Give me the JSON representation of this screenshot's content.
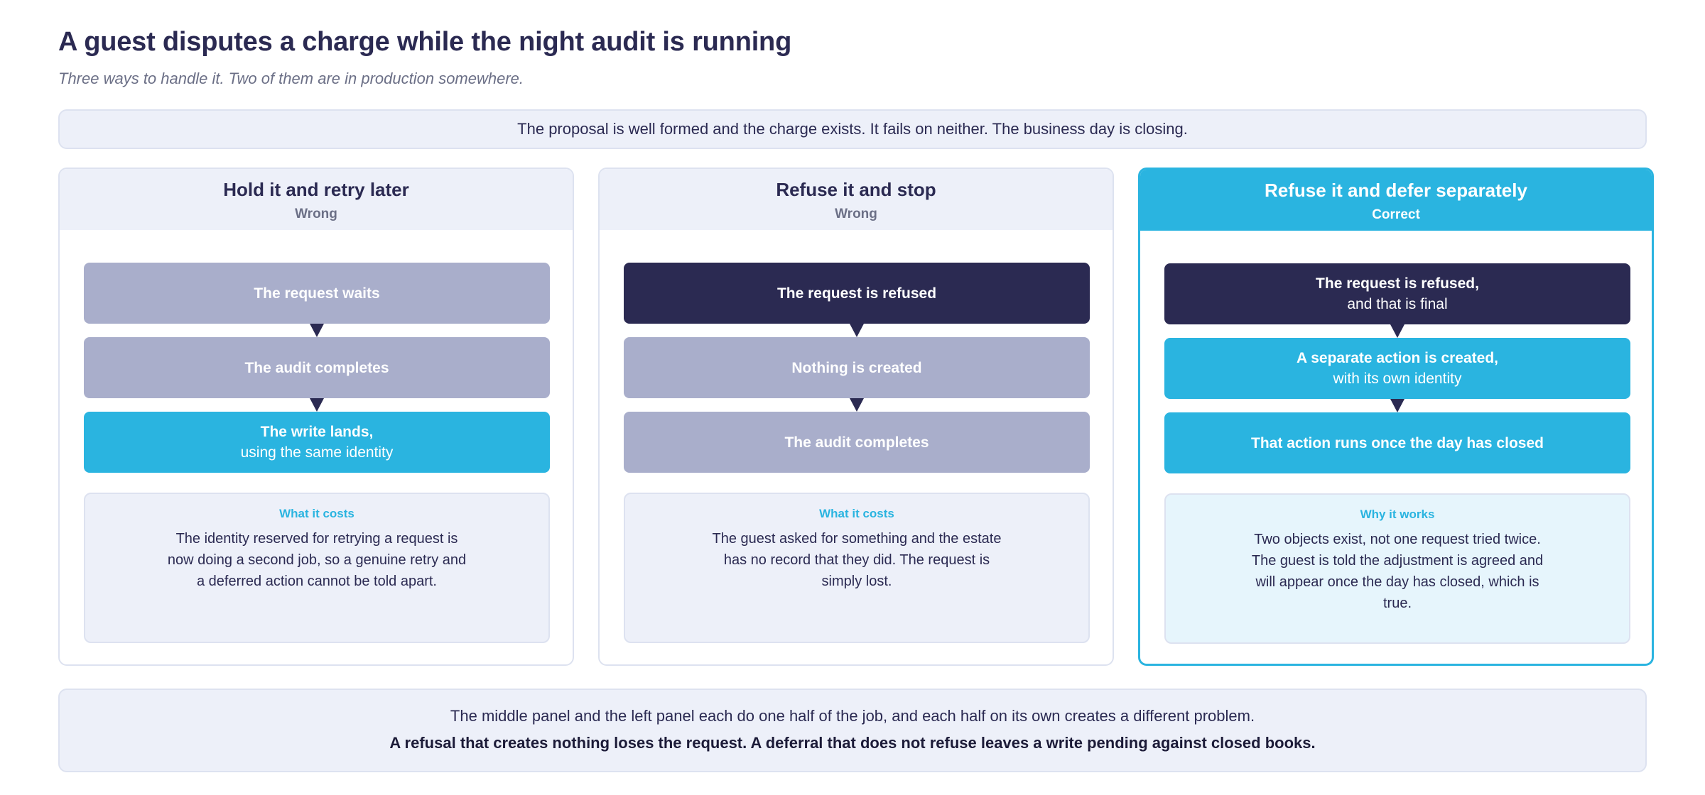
{
  "header": {
    "title": "A guest disputes a charge while the night audit is running",
    "subtitle": "Three ways to handle it. Two of them are in production somewhere."
  },
  "banner": {
    "text": "The proposal is well formed and the charge exists. It fails on neither. The business day is closing."
  },
  "colors": {
    "navy": "#2b2a52",
    "grey": "#a9aecb",
    "blue": "#2ab4e0",
    "panel_bg": "#edf0f9",
    "correct_bg": "#e6f5fc"
  },
  "panels": [
    {
      "title": "Hold it and retry later",
      "verdict": "Wrong",
      "steps": [
        {
          "main": "The request waits",
          "sub": "",
          "style": "grey"
        },
        {
          "main": "The audit completes",
          "sub": "",
          "style": "grey"
        },
        {
          "main": "The write lands,",
          "sub": "using the same identity",
          "style": "blue"
        }
      ],
      "box_label": "What it costs",
      "box_text": "The identity reserved for retrying a request is now doing a second job, so a genuine retry and a deferred action cannot be told apart."
    },
    {
      "title": "Refuse it and stop",
      "verdict": "Wrong",
      "steps": [
        {
          "main": "The request is refused",
          "sub": "",
          "style": "navy"
        },
        {
          "main": "Nothing is created",
          "sub": "",
          "style": "grey"
        },
        {
          "main": "The audit completes",
          "sub": "",
          "style": "grey"
        }
      ],
      "box_label": "What it costs",
      "box_text": "The guest asked for something and the estate has no record that they did. The request is simply lost."
    },
    {
      "title": "Refuse it and defer separately",
      "verdict": "Correct",
      "steps": [
        {
          "main": "The request is refused,",
          "sub": "and that is final",
          "style": "navy"
        },
        {
          "main": "A separate action is created,",
          "sub": "with its own identity",
          "style": "blue"
        },
        {
          "main": "That action runs once the day has closed",
          "sub": "",
          "style": "blue"
        }
      ],
      "box_label": "Why it works",
      "box_text": "Two objects exist, not one request tried twice. The guest is told the adjustment is agreed and will appear once the day has closed, which is true."
    }
  ],
  "footer": {
    "line1": "The middle panel and the left panel each do one half of the job, and each half on its own creates a different problem.",
    "line2": "A refusal that creates nothing loses the request. A deferral that does not refuse leaves a write pending against closed books."
  }
}
